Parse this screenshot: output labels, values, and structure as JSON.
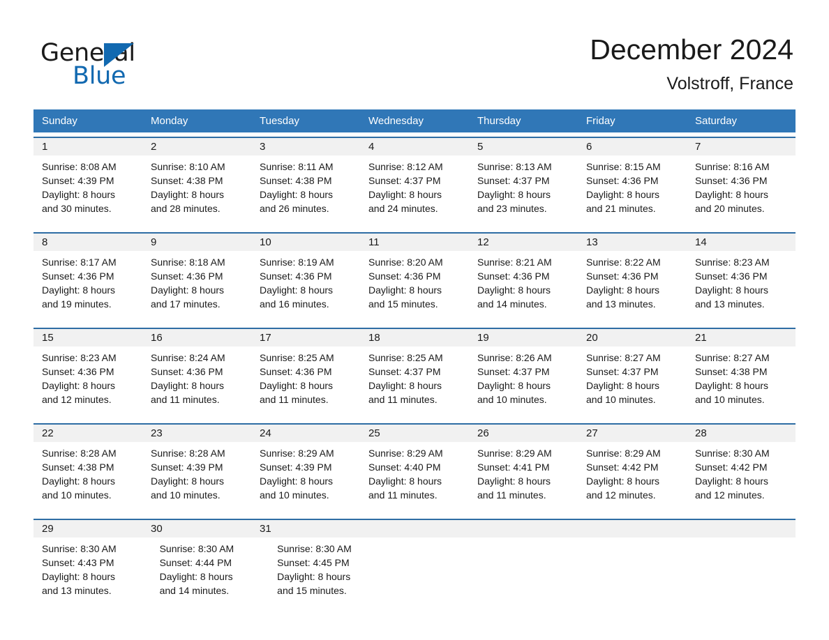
{
  "brand": {
    "name_dark": "General",
    "name_blue": "Blue",
    "accent_color": "#1269b0"
  },
  "header": {
    "title": "December 2024",
    "subtitle": "Volstroff, France"
  },
  "calendar": {
    "header_bg": "#3077b7",
    "row_divider_color": "#2e6da4",
    "date_band_bg": "#f1f1f1",
    "weekdays": [
      "Sunday",
      "Monday",
      "Tuesday",
      "Wednesday",
      "Thursday",
      "Friday",
      "Saturday"
    ],
    "weeks": [
      [
        {
          "date": "1",
          "sunrise": "Sunrise: 8:08 AM",
          "sunset": "Sunset: 4:39 PM",
          "daylight_1": "Daylight: 8 hours",
          "daylight_2": "and 30 minutes."
        },
        {
          "date": "2",
          "sunrise": "Sunrise: 8:10 AM",
          "sunset": "Sunset: 4:38 PM",
          "daylight_1": "Daylight: 8 hours",
          "daylight_2": "and 28 minutes."
        },
        {
          "date": "3",
          "sunrise": "Sunrise: 8:11 AM",
          "sunset": "Sunset: 4:38 PM",
          "daylight_1": "Daylight: 8 hours",
          "daylight_2": "and 26 minutes."
        },
        {
          "date": "4",
          "sunrise": "Sunrise: 8:12 AM",
          "sunset": "Sunset: 4:37 PM",
          "daylight_1": "Daylight: 8 hours",
          "daylight_2": "and 24 minutes."
        },
        {
          "date": "5",
          "sunrise": "Sunrise: 8:13 AM",
          "sunset": "Sunset: 4:37 PM",
          "daylight_1": "Daylight: 8 hours",
          "daylight_2": "and 23 minutes."
        },
        {
          "date": "6",
          "sunrise": "Sunrise: 8:15 AM",
          "sunset": "Sunset: 4:36 PM",
          "daylight_1": "Daylight: 8 hours",
          "daylight_2": "and 21 minutes."
        },
        {
          "date": "7",
          "sunrise": "Sunrise: 8:16 AM",
          "sunset": "Sunset: 4:36 PM",
          "daylight_1": "Daylight: 8 hours",
          "daylight_2": "and 20 minutes."
        }
      ],
      [
        {
          "date": "8",
          "sunrise": "Sunrise: 8:17 AM",
          "sunset": "Sunset: 4:36 PM",
          "daylight_1": "Daylight: 8 hours",
          "daylight_2": "and 19 minutes."
        },
        {
          "date": "9",
          "sunrise": "Sunrise: 8:18 AM",
          "sunset": "Sunset: 4:36 PM",
          "daylight_1": "Daylight: 8 hours",
          "daylight_2": "and 17 minutes."
        },
        {
          "date": "10",
          "sunrise": "Sunrise: 8:19 AM",
          "sunset": "Sunset: 4:36 PM",
          "daylight_1": "Daylight: 8 hours",
          "daylight_2": "and 16 minutes."
        },
        {
          "date": "11",
          "sunrise": "Sunrise: 8:20 AM",
          "sunset": "Sunset: 4:36 PM",
          "daylight_1": "Daylight: 8 hours",
          "daylight_2": "and 15 minutes."
        },
        {
          "date": "12",
          "sunrise": "Sunrise: 8:21 AM",
          "sunset": "Sunset: 4:36 PM",
          "daylight_1": "Daylight: 8 hours",
          "daylight_2": "and 14 minutes."
        },
        {
          "date": "13",
          "sunrise": "Sunrise: 8:22 AM",
          "sunset": "Sunset: 4:36 PM",
          "daylight_1": "Daylight: 8 hours",
          "daylight_2": "and 13 minutes."
        },
        {
          "date": "14",
          "sunrise": "Sunrise: 8:23 AM",
          "sunset": "Sunset: 4:36 PM",
          "daylight_1": "Daylight: 8 hours",
          "daylight_2": "and 13 minutes."
        }
      ],
      [
        {
          "date": "15",
          "sunrise": "Sunrise: 8:23 AM",
          "sunset": "Sunset: 4:36 PM",
          "daylight_1": "Daylight: 8 hours",
          "daylight_2": "and 12 minutes."
        },
        {
          "date": "16",
          "sunrise": "Sunrise: 8:24 AM",
          "sunset": "Sunset: 4:36 PM",
          "daylight_1": "Daylight: 8 hours",
          "daylight_2": "and 11 minutes."
        },
        {
          "date": "17",
          "sunrise": "Sunrise: 8:25 AM",
          "sunset": "Sunset: 4:36 PM",
          "daylight_1": "Daylight: 8 hours",
          "daylight_2": "and 11 minutes."
        },
        {
          "date": "18",
          "sunrise": "Sunrise: 8:25 AM",
          "sunset": "Sunset: 4:37 PM",
          "daylight_1": "Daylight: 8 hours",
          "daylight_2": "and 11 minutes."
        },
        {
          "date": "19",
          "sunrise": "Sunrise: 8:26 AM",
          "sunset": "Sunset: 4:37 PM",
          "daylight_1": "Daylight: 8 hours",
          "daylight_2": "and 10 minutes."
        },
        {
          "date": "20",
          "sunrise": "Sunrise: 8:27 AM",
          "sunset": "Sunset: 4:37 PM",
          "daylight_1": "Daylight: 8 hours",
          "daylight_2": "and 10 minutes."
        },
        {
          "date": "21",
          "sunrise": "Sunrise: 8:27 AM",
          "sunset": "Sunset: 4:38 PM",
          "daylight_1": "Daylight: 8 hours",
          "daylight_2": "and 10 minutes."
        }
      ],
      [
        {
          "date": "22",
          "sunrise": "Sunrise: 8:28 AM",
          "sunset": "Sunset: 4:38 PM",
          "daylight_1": "Daylight: 8 hours",
          "daylight_2": "and 10 minutes."
        },
        {
          "date": "23",
          "sunrise": "Sunrise: 8:28 AM",
          "sunset": "Sunset: 4:39 PM",
          "daylight_1": "Daylight: 8 hours",
          "daylight_2": "and 10 minutes."
        },
        {
          "date": "24",
          "sunrise": "Sunrise: 8:29 AM",
          "sunset": "Sunset: 4:39 PM",
          "daylight_1": "Daylight: 8 hours",
          "daylight_2": "and 10 minutes."
        },
        {
          "date": "25",
          "sunrise": "Sunrise: 8:29 AM",
          "sunset": "Sunset: 4:40 PM",
          "daylight_1": "Daylight: 8 hours",
          "daylight_2": "and 11 minutes."
        },
        {
          "date": "26",
          "sunrise": "Sunrise: 8:29 AM",
          "sunset": "Sunset: 4:41 PM",
          "daylight_1": "Daylight: 8 hours",
          "daylight_2": "and 11 minutes."
        },
        {
          "date": "27",
          "sunrise": "Sunrise: 8:29 AM",
          "sunset": "Sunset: 4:42 PM",
          "daylight_1": "Daylight: 8 hours",
          "daylight_2": "and 12 minutes."
        },
        {
          "date": "28",
          "sunrise": "Sunrise: 8:30 AM",
          "sunset": "Sunset: 4:42 PM",
          "daylight_1": "Daylight: 8 hours",
          "daylight_2": "and 12 minutes."
        }
      ],
      [
        {
          "date": "29",
          "sunrise": "Sunrise: 8:30 AM",
          "sunset": "Sunset: 4:43 PM",
          "daylight_1": "Daylight: 8 hours",
          "daylight_2": "and 13 minutes."
        },
        {
          "date": "30",
          "sunrise": "Sunrise: 8:30 AM",
          "sunset": "Sunset: 4:44 PM",
          "daylight_1": "Daylight: 8 hours",
          "daylight_2": "and 14 minutes."
        },
        {
          "date": "31",
          "sunrise": "Sunrise: 8:30 AM",
          "sunset": "Sunset: 4:45 PM",
          "daylight_1": "Daylight: 8 hours",
          "daylight_2": "and 15 minutes."
        },
        {
          "date": "",
          "sunrise": "",
          "sunset": "",
          "daylight_1": "",
          "daylight_2": ""
        },
        {
          "date": "",
          "sunrise": "",
          "sunset": "",
          "daylight_1": "",
          "daylight_2": ""
        },
        {
          "date": "",
          "sunrise": "",
          "sunset": "",
          "daylight_1": "",
          "daylight_2": ""
        },
        {
          "date": "",
          "sunrise": "",
          "sunset": "",
          "daylight_1": "",
          "daylight_2": ""
        }
      ]
    ]
  }
}
